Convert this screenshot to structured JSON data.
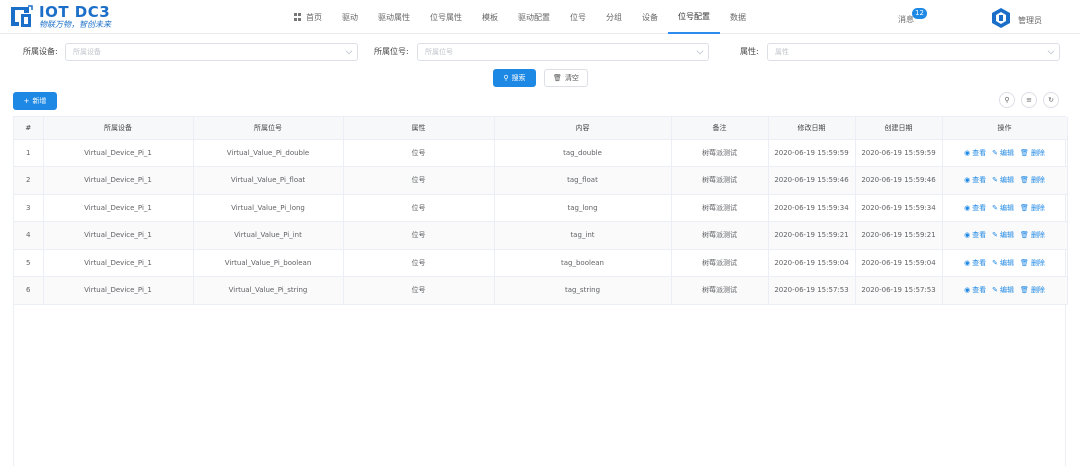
{
  "header": {
    "logo_title": "IOT DC3",
    "logo_slogan": "物联万物，智创未来",
    "nav": [
      {
        "label": "首页",
        "active": false,
        "home": true
      },
      {
        "label": "驱动",
        "active": false
      },
      {
        "label": "驱动属性",
        "active": false
      },
      {
        "label": "位号属性",
        "active": false
      },
      {
        "label": "模板",
        "active": false
      },
      {
        "label": "驱动配置",
        "active": false
      },
      {
        "label": "位号",
        "active": false
      },
      {
        "label": "分组",
        "active": false
      },
      {
        "label": "设备",
        "active": false
      },
      {
        "label": "位号配置",
        "active": true
      },
      {
        "label": "数据",
        "active": false
      }
    ],
    "message_label": "消息",
    "message_count": "12",
    "user_name": "管理员"
  },
  "filters": {
    "device_label": "所属设备:",
    "device_placeholder": "所属设备",
    "point_label": "所属位号:",
    "point_placeholder": "所属位号",
    "attr_label": "属性:",
    "attr_placeholder": "属性"
  },
  "actions": {
    "search_label": "搜索",
    "clear_label": "清空",
    "add_label": "新增"
  },
  "table": {
    "columns": [
      "#",
      "所属设备",
      "所属位号",
      "属性",
      "内容",
      "备注",
      "修改日期",
      "创建日期",
      "操作"
    ],
    "op_view": "查看",
    "op_edit": "编辑",
    "op_delete": "删除",
    "rows": [
      {
        "idx": "1",
        "device": "Virtual_Device_Pi_1",
        "point": "Virtual_Value_Pi_double",
        "attr": "位号",
        "content": "tag_double",
        "remark": "树莓派测试",
        "updated": "2020-06-19 15:59:59",
        "created": "2020-06-19 15:59:59"
      },
      {
        "idx": "2",
        "device": "Virtual_Device_Pi_1",
        "point": "Virtual_Value_Pi_float",
        "attr": "位号",
        "content": "tag_float",
        "remark": "树莓派测试",
        "updated": "2020-06-19 15:59:46",
        "created": "2020-06-19 15:59:46"
      },
      {
        "idx": "3",
        "device": "Virtual_Device_Pi_1",
        "point": "Virtual_Value_Pi_long",
        "attr": "位号",
        "content": "tag_long",
        "remark": "树莓派测试",
        "updated": "2020-06-19 15:59:34",
        "created": "2020-06-19 15:59:34"
      },
      {
        "idx": "4",
        "device": "Virtual_Device_Pi_1",
        "point": "Virtual_Value_Pi_int",
        "attr": "位号",
        "content": "tag_int",
        "remark": "树莓派测试",
        "updated": "2020-06-19 15:59:21",
        "created": "2020-06-19 15:59:21"
      },
      {
        "idx": "5",
        "device": "Virtual_Device_Pi_1",
        "point": "Virtual_Value_Pi_boolean",
        "attr": "位号",
        "content": "tag_boolean",
        "remark": "树莓派测试",
        "updated": "2020-06-19 15:59:04",
        "created": "2020-06-19 15:59:04"
      },
      {
        "idx": "6",
        "device": "Virtual_Device_Pi_1",
        "point": "Virtual_Value_Pi_string",
        "attr": "位号",
        "content": "tag_string",
        "remark": "树莓派测试",
        "updated": "2020-06-19 15:57:53",
        "created": "2020-06-19 15:57:53"
      }
    ]
  },
  "colors": {
    "primary": "#1e88e5",
    "logo": "#1b6fc8",
    "active_underline": "#2d8cf0"
  },
  "icons": {
    "home": "grid-icon",
    "search": "search-icon",
    "clear": "trash-icon",
    "add": "plus-icon",
    "view": "eye-icon",
    "edit": "edit-icon",
    "delete": "trash-icon",
    "refresh": "refresh-icon",
    "column_settings": "sliders-icon"
  }
}
